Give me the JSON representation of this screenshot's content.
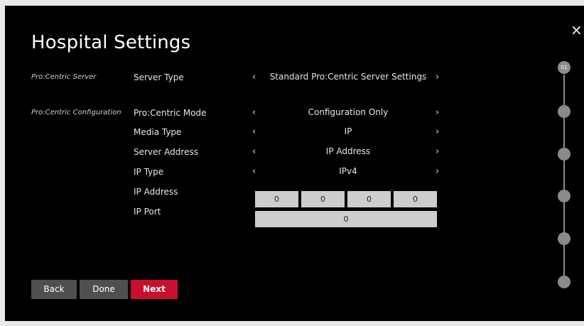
{
  "title": "Hospital Settings",
  "close_glyph": "×",
  "sections": {
    "server": "Pro:Centric Server",
    "configuration": "Pro:Centric Configuration"
  },
  "rows": {
    "server_type": {
      "label": "Server Type",
      "value": "Standard Pro:Centric Server Settings"
    },
    "mode": {
      "label": "Pro:Centric Mode",
      "value": "Configuration Only"
    },
    "media_type": {
      "label": "Media Type",
      "value": "IP"
    },
    "server_address": {
      "label": "Server Address",
      "value": "IP Address"
    },
    "ip_type": {
      "label": "IP Type",
      "value": "IPv4"
    },
    "ip_address": {
      "label": "IP Address",
      "octets": [
        "0",
        "0",
        "0",
        "0"
      ]
    },
    "ip_port": {
      "label": "IP Port",
      "value": "0"
    }
  },
  "arrows": {
    "left": "‹",
    "right": "›"
  },
  "buttons": {
    "back": "Back",
    "done": "Done",
    "next": "Next"
  },
  "stepper": {
    "current_label": "01",
    "total_steps": 6,
    "current_step": 1
  },
  "colors": {
    "accent": "#c8102e",
    "button_gray": "#4f4f4f",
    "field_gray": "#cdcdcd"
  }
}
